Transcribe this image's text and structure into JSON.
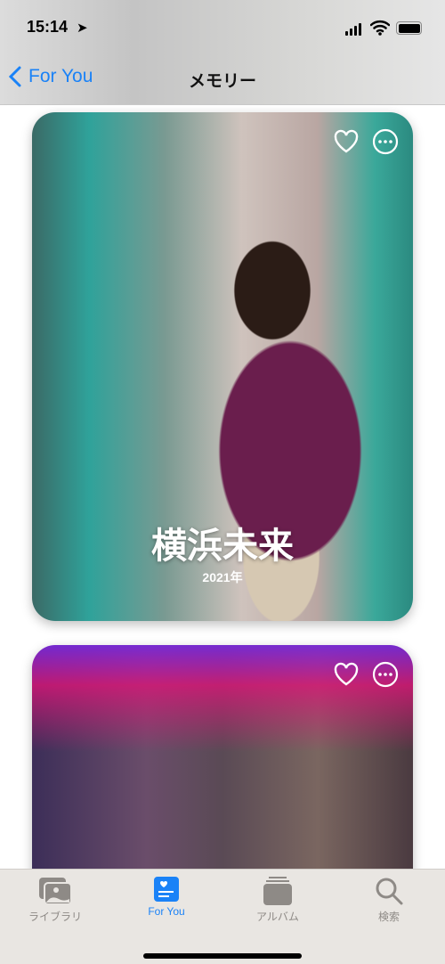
{
  "status": {
    "time": "15:14"
  },
  "nav": {
    "back_label": "For You",
    "title": "メモリー"
  },
  "memories": [
    {
      "title": "横浜未来",
      "year": "2021年"
    },
    {
      "title": "",
      "year": ""
    }
  ],
  "tabs": [
    {
      "label": "ライブラリ",
      "icon": "photo-library-icon"
    },
    {
      "label": "For You",
      "icon": "for-you-icon",
      "active": true
    },
    {
      "label": "アルバム",
      "icon": "album-stack-icon"
    },
    {
      "label": "検索",
      "icon": "search-icon"
    }
  ],
  "colors": {
    "accent": "#1a82f7"
  }
}
